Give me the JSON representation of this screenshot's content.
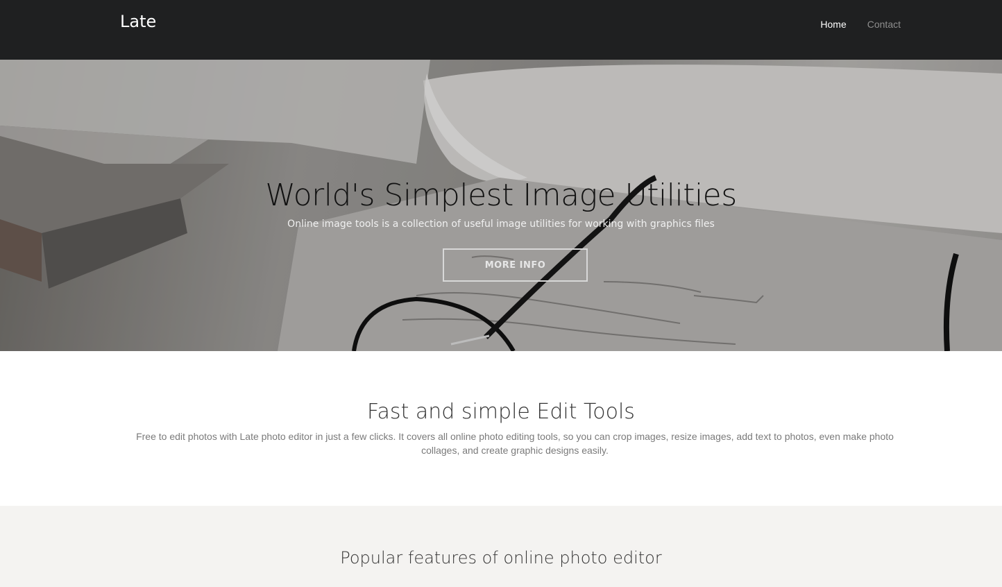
{
  "navbar": {
    "brand": "Late",
    "links": [
      {
        "label": "Home",
        "active": true
      },
      {
        "label": "Contact",
        "active": false
      }
    ]
  },
  "hero": {
    "title": "World's Simplest Image Utilities",
    "subtitle": "Online image tools is a collection of useful image utilities for working with graphics files",
    "button_label": "MORE INFO"
  },
  "features_intro": {
    "title": "Fast and simple Edit Tools",
    "text": "Free to edit photos with Late photo editor in just a few clicks. It covers all online photo editing tools, so you can crop images, resize images, add text to photos, even make photo collages, and create graphic designs easily."
  },
  "popular": {
    "title": "Popular features of online photo editor"
  },
  "colors": {
    "navbar_bg": "#1f2021",
    "section_grey_bg": "#f4f3f1"
  }
}
